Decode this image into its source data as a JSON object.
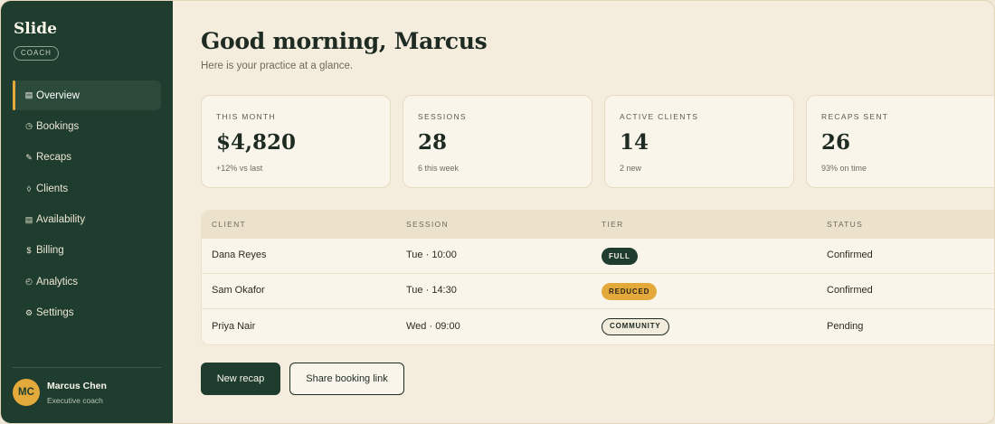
{
  "sidebar": {
    "brand": "Slide",
    "badge": "COACH",
    "items": [
      {
        "icon": "▤",
        "label": "Overview",
        "active": true
      },
      {
        "icon": "◷",
        "label": "Bookings"
      },
      {
        "icon": "✎",
        "label": "Recaps"
      },
      {
        "icon": "◊",
        "label": "Clients"
      },
      {
        "icon": "▤",
        "label": "Availability"
      },
      {
        "icon": "$",
        "label": "Billing"
      },
      {
        "icon": "◴",
        "label": "Analytics"
      },
      {
        "icon": "⚙",
        "label": "Settings"
      }
    ],
    "user": {
      "initials": "MC",
      "name": "Marcus Chen",
      "role": "Executive coach"
    }
  },
  "header": {
    "greeting": "Good morning, Marcus",
    "subtitle": "Here is your practice at a glance."
  },
  "stats": [
    {
      "label": "THIS MONTH",
      "value": "$4,820",
      "note": "+12% vs last"
    },
    {
      "label": "SESSIONS",
      "value": "28",
      "note": "6 this week"
    },
    {
      "label": "ACTIVE CLIENTS",
      "value": "14",
      "note": "2 new"
    },
    {
      "label": "RECAPS SENT",
      "value": "26",
      "note": "93% on time"
    }
  ],
  "table": {
    "headers": [
      "CLIENT",
      "SESSION",
      "TIER",
      "STATUS"
    ],
    "rows": [
      {
        "client": "Dana Reyes",
        "session": "Tue · 10:00",
        "tier": "FULL",
        "status": "Confirmed"
      },
      {
        "client": "Sam Okafor",
        "session": "Tue · 14:30",
        "tier": "REDUCED",
        "status": "Confirmed"
      },
      {
        "client": "Priya Nair",
        "session": "Wed · 09:00",
        "tier": "COMMUNITY",
        "status": "Pending"
      }
    ]
  },
  "actions": {
    "primary": "New recap",
    "secondary": "Share booking link"
  },
  "colors": {
    "sidebar": "#1f3d2f",
    "accent": "#e3a93b",
    "background": "#f4ecdd",
    "card": "#faf5ea"
  }
}
